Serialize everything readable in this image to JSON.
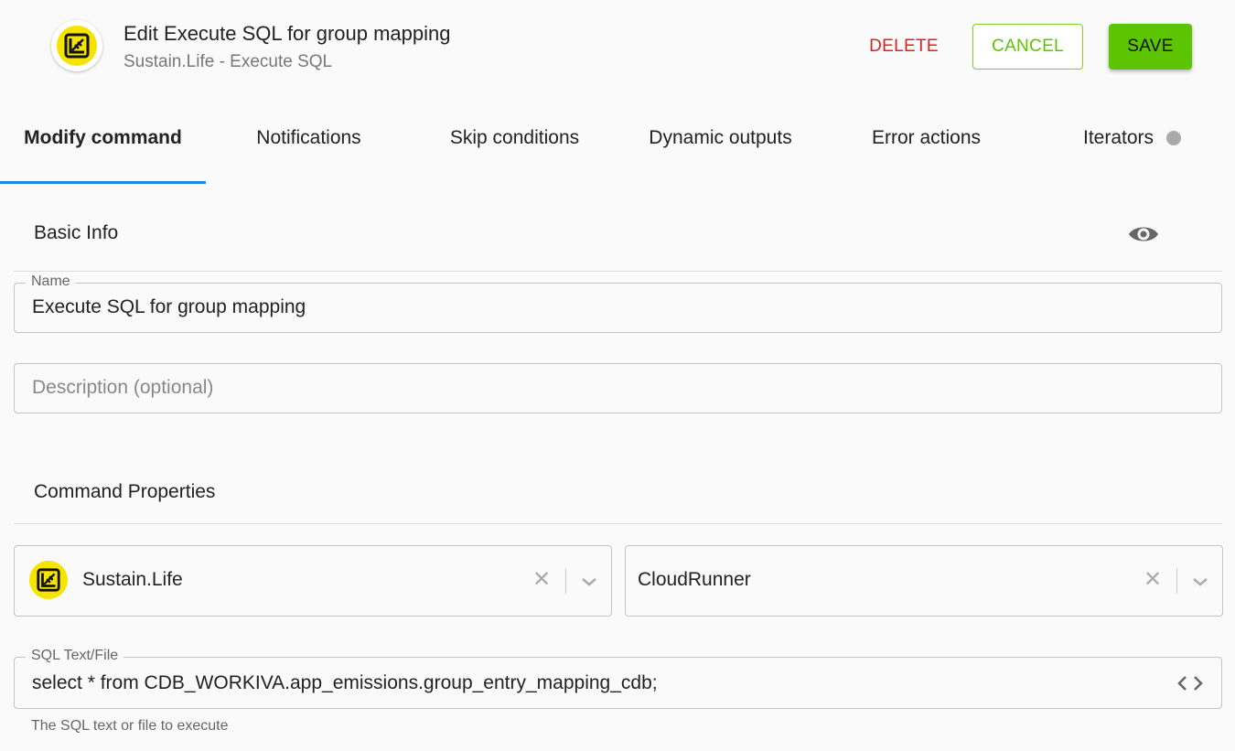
{
  "header": {
    "logo_icon": "sustain-life-leaf-icon",
    "title": "Edit Execute SQL for group mapping",
    "subtitle": "Sustain.Life - Execute SQL",
    "delete_label": "DELETE",
    "cancel_label": "CANCEL",
    "save_label": "SAVE"
  },
  "tabs": [
    {
      "label": "Modify command",
      "active": true
    },
    {
      "label": "Notifications"
    },
    {
      "label": "Skip conditions"
    },
    {
      "label": "Dynamic outputs"
    },
    {
      "label": "Error actions"
    },
    {
      "label": "Iterators"
    }
  ],
  "basic_info": {
    "title": "Basic Info",
    "visibility_icon": "eye-icon",
    "name_label": "Name",
    "name_value": "Execute SQL for group mapping",
    "description_placeholder": "Description (optional)"
  },
  "command_properties": {
    "title": "Command Properties",
    "connector_value": "Sustain.Life",
    "runner_value": "CloudRunner",
    "sql_label": "SQL Text/File",
    "sql_value": "select * from CDB_WORKIVA.app_emissions.group_entry_mapping_cdb;",
    "sql_helper": "The SQL text or file to execute"
  },
  "colors": {
    "accent_green": "#5cc400",
    "delete_red": "#e02020",
    "tab_underline": "#1e88e5",
    "logo_yellow": "#f5e400"
  }
}
